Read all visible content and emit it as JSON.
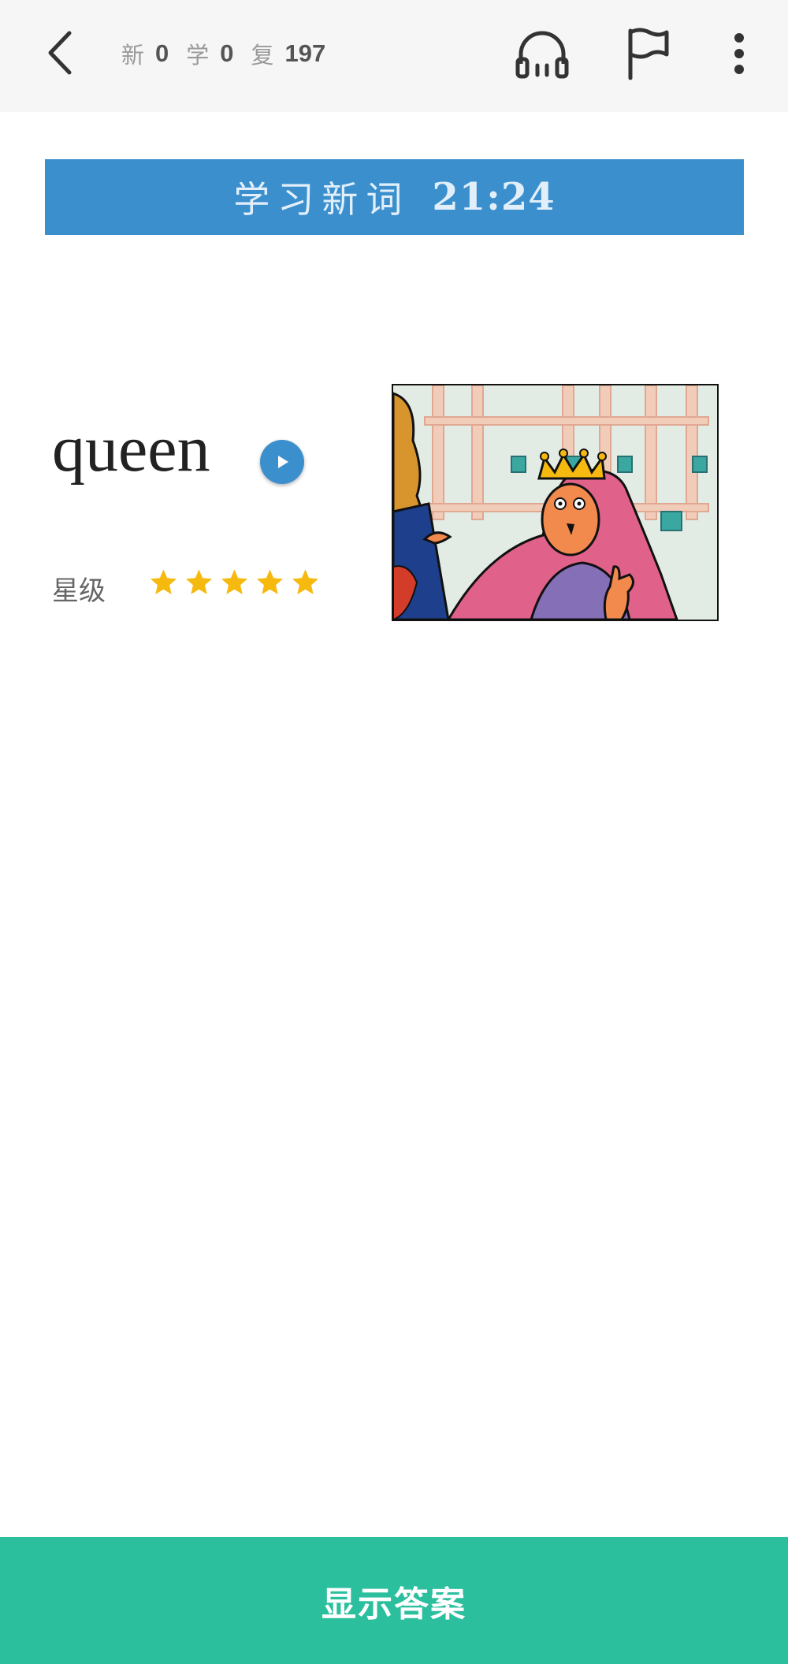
{
  "header": {
    "counters": [
      {
        "label": "新",
        "value": "0"
      },
      {
        "label": "学",
        "value": "0"
      },
      {
        "label": "复",
        "value": "197"
      }
    ],
    "icons": [
      "back-arrow-icon",
      "headphones-icon",
      "flag-icon",
      "more-vertical-icon"
    ]
  },
  "banner": {
    "title": "学习新词",
    "time": "21:24",
    "color": "#3b8fcd"
  },
  "card": {
    "word": "queen",
    "rating_label": "星级",
    "stars": 5,
    "star_color": "#f6b90f",
    "image": "queen-cartoon-illustration"
  },
  "footer": {
    "button_label": "显示答案",
    "color": "#2bbf9e"
  }
}
